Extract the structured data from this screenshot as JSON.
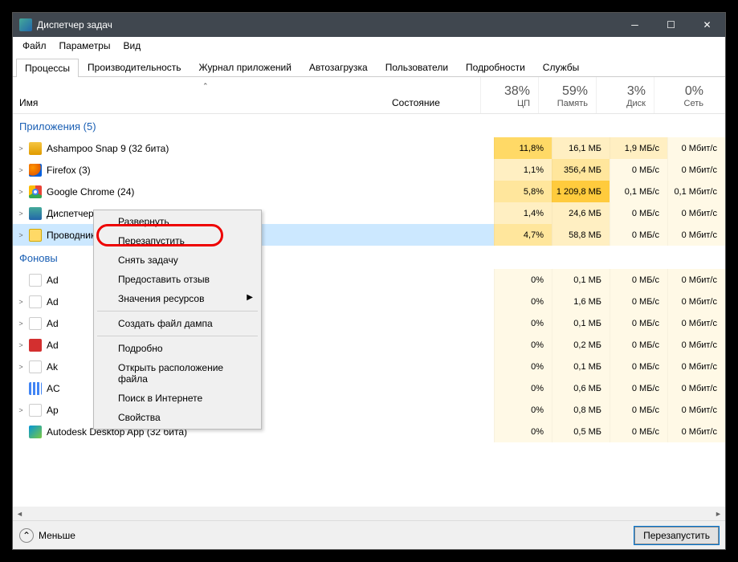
{
  "title": "Диспетчер задач",
  "menus": [
    "Файл",
    "Параметры",
    "Вид"
  ],
  "tabs": [
    "Процессы",
    "Производительность",
    "Журнал приложений",
    "Автозагрузка",
    "Пользователи",
    "Подробности",
    "Службы"
  ],
  "active_tab": 0,
  "columns": {
    "name": "Имя",
    "state": "Состояние",
    "metrics": [
      {
        "pct": "38%",
        "label": "ЦП"
      },
      {
        "pct": "59%",
        "label": "Память"
      },
      {
        "pct": "3%",
        "label": "Диск"
      },
      {
        "pct": "0%",
        "label": "Сеть"
      }
    ]
  },
  "groups": [
    {
      "title": "Приложения (5)",
      "rows": [
        {
          "icon": "i-snap",
          "name": "Ashampoo Snap 9 (32 бита)",
          "exp": true,
          "cells": [
            {
              "v": "11,8%",
              "h": 3
            },
            {
              "v": "16,1 МБ",
              "h": 1
            },
            {
              "v": "1,9 МБ/с",
              "h": 1
            },
            {
              "v": "0 Мбит/с",
              "h": 0
            }
          ]
        },
        {
          "icon": "i-ff",
          "name": "Firefox (3)",
          "exp": true,
          "cells": [
            {
              "v": "1,1%",
              "h": 1
            },
            {
              "v": "356,4 МБ",
              "h": 2
            },
            {
              "v": "0 МБ/с",
              "h": 0
            },
            {
              "v": "0 Мбит/с",
              "h": 0
            }
          ]
        },
        {
          "icon": "i-chrome",
          "name": "Google Chrome (24)",
          "exp": true,
          "cells": [
            {
              "v": "5,8%",
              "h": 2
            },
            {
              "v": "1 209,8 МБ",
              "h": 4
            },
            {
              "v": "0,1 МБ/с",
              "h": 0
            },
            {
              "v": "0,1 Мбит/с",
              "h": 0
            }
          ]
        },
        {
          "icon": "i-tm",
          "name": "Диспетчер задач",
          "exp": true,
          "cells": [
            {
              "v": "1,4%",
              "h": 1
            },
            {
              "v": "24,6 МБ",
              "h": 1
            },
            {
              "v": "0 МБ/с",
              "h": 0
            },
            {
              "v": "0 Мбит/с",
              "h": 0
            }
          ]
        },
        {
          "icon": "i-exp",
          "name": "Проводник (2)",
          "exp": true,
          "selected": true,
          "cells": [
            {
              "v": "4,7%",
              "h": 2
            },
            {
              "v": "58,8 МБ",
              "h": 1
            },
            {
              "v": "0 МБ/с",
              "h": 0
            },
            {
              "v": "0 Мбит/с",
              "h": 0
            }
          ]
        }
      ]
    },
    {
      "title": "Фоновы",
      "rows": [
        {
          "icon": "i-ad",
          "name": "Ad",
          "exp": false,
          "cells": [
            {
              "v": "0%",
              "h": 0
            },
            {
              "v": "0,1 МБ",
              "h": 0
            },
            {
              "v": "0 МБ/с",
              "h": 0
            },
            {
              "v": "0 Мбит/с",
              "h": 0
            }
          ]
        },
        {
          "icon": "i-ad",
          "name": "Ad",
          "exp": true,
          "cells": [
            {
              "v": "0%",
              "h": 0
            },
            {
              "v": "1,6 МБ",
              "h": 0
            },
            {
              "v": "0 МБ/с",
              "h": 0
            },
            {
              "v": "0 Мбит/с",
              "h": 0
            }
          ]
        },
        {
          "icon": "i-ad",
          "name": "Ad",
          "exp": true,
          "cells": [
            {
              "v": "0%",
              "h": 0
            },
            {
              "v": "0,1 МБ",
              "h": 0
            },
            {
              "v": "0 МБ/с",
              "h": 0
            },
            {
              "v": "0 Мбит/с",
              "h": 0
            }
          ]
        },
        {
          "icon": "i-red",
          "name": "Ad",
          "exp": true,
          "cells": [
            {
              "v": "0%",
              "h": 0
            },
            {
              "v": "0,2 МБ",
              "h": 0
            },
            {
              "v": "0 МБ/с",
              "h": 0
            },
            {
              "v": "0 Мбит/с",
              "h": 0
            }
          ]
        },
        {
          "icon": "i-ad",
          "name": "Ak",
          "exp": true,
          "cells": [
            {
              "v": "0%",
              "h": 0
            },
            {
              "v": "0,1 МБ",
              "h": 0
            },
            {
              "v": "0 МБ/с",
              "h": 0
            },
            {
              "v": "0 Мбит/с",
              "h": 0
            }
          ]
        },
        {
          "icon": "i-grid",
          "name": "AC",
          "exp": false,
          "cells": [
            {
              "v": "0%",
              "h": 0
            },
            {
              "v": "0,6 МБ",
              "h": 0
            },
            {
              "v": "0 МБ/с",
              "h": 0
            },
            {
              "v": "0 Мбит/с",
              "h": 0
            }
          ]
        },
        {
          "icon": "i-ad",
          "name": "Ap",
          "exp": true,
          "cells": [
            {
              "v": "0%",
              "h": 0
            },
            {
              "v": "0,8 МБ",
              "h": 0
            },
            {
              "v": "0 МБ/с",
              "h": 0
            },
            {
              "v": "0 Мбит/с",
              "h": 0
            }
          ]
        },
        {
          "icon": "i-auto",
          "name": "Autodesk Desktop App (32 бита)",
          "exp": false,
          "cells": [
            {
              "v": "0%",
              "h": 0
            },
            {
              "v": "0,5 МБ",
              "h": 0
            },
            {
              "v": "0 МБ/с",
              "h": 0
            },
            {
              "v": "0 Мбит/с",
              "h": 0
            }
          ]
        }
      ]
    }
  ],
  "context_menu": {
    "items": [
      {
        "label": "Развернуть"
      },
      {
        "label": "Перезапустить",
        "highlighted": true
      },
      {
        "label": "Снять задачу"
      },
      {
        "label": "Предоставить отзыв"
      },
      {
        "label": "Значения ресурсов",
        "submenu": true
      },
      {
        "sep": true
      },
      {
        "label": "Создать файл дампа"
      },
      {
        "sep": true
      },
      {
        "label": "Подробно"
      },
      {
        "label": "Открыть расположение файла"
      },
      {
        "label": "Поиск в Интернете"
      },
      {
        "label": "Свойства"
      }
    ]
  },
  "footer": {
    "less": "Меньше",
    "action": "Перезапустить"
  }
}
